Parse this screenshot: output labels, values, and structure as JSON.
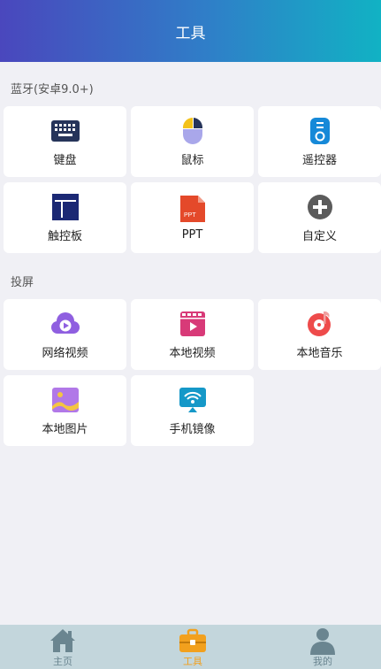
{
  "header": {
    "title": "工具"
  },
  "sections": {
    "bluetooth": {
      "title": "蓝牙(安卓9.0+)",
      "items": [
        {
          "label": "键盘",
          "icon": "keyboard-icon"
        },
        {
          "label": "鼠标",
          "icon": "mouse-icon"
        },
        {
          "label": "遥控器",
          "icon": "remote-icon"
        },
        {
          "label": "触控板",
          "icon": "touchpad-icon"
        },
        {
          "label": "PPT",
          "icon": "ppt-icon"
        },
        {
          "label": "自定义",
          "icon": "add-circle-icon"
        }
      ]
    },
    "cast": {
      "title": "投屏",
      "items": [
        {
          "label": "网络视频",
          "icon": "cloud-video-icon"
        },
        {
          "label": "本地视频",
          "icon": "film-icon"
        },
        {
          "label": "本地音乐",
          "icon": "music-disc-icon"
        },
        {
          "label": "本地图片",
          "icon": "image-icon"
        },
        {
          "label": "手机镜像",
          "icon": "mirror-icon"
        }
      ]
    }
  },
  "ppt_icon_text": "PPT",
  "tabbar": {
    "items": [
      {
        "label": "主页",
        "icon": "home-icon",
        "active": false
      },
      {
        "label": "工具",
        "icon": "toolbox-icon",
        "active": true
      },
      {
        "label": "我的",
        "icon": "person-icon",
        "active": false
      }
    ]
  },
  "colors": {
    "header_start": "#4a47bd",
    "header_end": "#11b2c4",
    "active_tab": "#f2a01d",
    "inactive_tab": "#6a8590",
    "background": "#f0f0f5",
    "tabbar_bg": "#c3d6dc"
  }
}
